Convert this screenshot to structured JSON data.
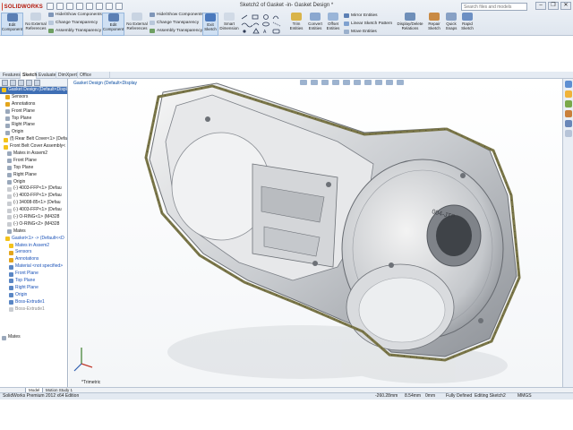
{
  "app": {
    "name": "SOLIDWORKS",
    "window_title": "Sketch2 of Gasket -in- Gasket Design *",
    "search_placeholder": "Search files and models",
    "win_minimize": "–",
    "win_restore": "❐",
    "win_close": "✕"
  },
  "ribbon": {
    "edit_component": "Edit Component",
    "no_external_references": "No External References",
    "hide_show_components": "Hide/Show Components",
    "change_transparency": "Change Transparency",
    "assembly_transparency": "Assembly Transparency",
    "edit_component_2": "Edit Component",
    "no_external_references_2": "No External References",
    "hide_show_components_2": "Hide/Show Components",
    "change_transparency_2": "Change Transparency",
    "assembly_transparency_2": "Assembly Transparency",
    "exit_sketch": "Exit Sketch",
    "smart_dimension": "Smart Dimension",
    "trim_entities": "Trim Entities",
    "convert_entities": "Convert Entities",
    "offset_entities": "Offset Entities",
    "mirror_entities": "Mirror Entities",
    "linear_sketch_pattern": "Linear Sketch Pattern",
    "move_entities": "Move Entities",
    "display_delete_relations": "Display/Delete Relations",
    "repair_sketch": "Repair Sketch",
    "quick_snaps": "Quick Snaps",
    "rapid_sketch": "Rapid Sketch"
  },
  "tabs": [
    "Features",
    "Sketch",
    "Evaluate",
    "DimXpert",
    "Office Products"
  ],
  "active_tab": "Sketch",
  "tree": [
    {
      "label": "Gasket Design  (Default<Display",
      "style": "hl",
      "color": "#f3c21b"
    },
    {
      "label": "Sensors",
      "style": "",
      "color": "#e3a51c"
    },
    {
      "label": "Annotations",
      "style": "",
      "color": "#e3a51c"
    },
    {
      "label": "Front Plane",
      "style": "",
      "color": "#9aa8bb"
    },
    {
      "label": "Top Plane",
      "style": "",
      "color": "#9aa8bb"
    },
    {
      "label": "Right Plane",
      "style": "",
      "color": "#9aa8bb"
    },
    {
      "label": "Origin",
      "style": "",
      "color": "#9aa8bb"
    },
    {
      "label": "(f) Rear Belt Cover<1> (Defa",
      "style": "",
      "color": "#f3c21b"
    },
    {
      "label": "Front Belt Cover Assembly<",
      "style": "",
      "color": "#f3c21b"
    },
    {
      "label": "Mates in Assem2",
      "style": "",
      "color": "#9aa8bb"
    },
    {
      "label": "Front Plane",
      "style": "",
      "color": "#9aa8bb"
    },
    {
      "label": "Top Plane",
      "style": "",
      "color": "#9aa8bb"
    },
    {
      "label": "Right Plane",
      "style": "",
      "color": "#9aa8bb"
    },
    {
      "label": "Origin",
      "style": "",
      "color": "#9aa8bb"
    },
    {
      "label": "(-) 4003-FFP<1> (Defau",
      "style": "",
      "color": "#c9ccd1"
    },
    {
      "label": "(-) 4003-FFP<1> (Defau",
      "style": "",
      "color": "#c9ccd1"
    },
    {
      "label": "(-) 34008-85<1> (Defau",
      "style": "",
      "color": "#c9ccd1"
    },
    {
      "label": "(-) 4003-FFP<1> (Defau",
      "style": "",
      "color": "#c9ccd1"
    },
    {
      "label": "(-) O-RING<1> (M4328",
      "style": "",
      "color": "#c9ccd1"
    },
    {
      "label": "(-) O-RING<2> (M4328",
      "style": "",
      "color": "#c9ccd1"
    },
    {
      "label": "Mates",
      "style": "",
      "color": "#9aa8bb"
    },
    {
      "label": "Gasket<1> -> (Default<<D",
      "style": "blue",
      "color": "#f3c21b"
    },
    {
      "label": "Mates in Assem2",
      "style": "blue",
      "color": "#f3c21b"
    },
    {
      "label": "Sensors",
      "style": "blue",
      "color": "#e3a51c"
    },
    {
      "label": "Annotations",
      "style": "blue",
      "color": "#e3a51c"
    },
    {
      "label": "Material <not specified>",
      "style": "blue",
      "color": "#5a86c4"
    },
    {
      "label": "Front Plane",
      "style": "blue",
      "color": "#5a86c4"
    },
    {
      "label": "Top Plane",
      "style": "blue",
      "color": "#5a86c4"
    },
    {
      "label": "Right Plane",
      "style": "blue",
      "color": "#5a86c4"
    },
    {
      "label": "Origin",
      "style": "blue",
      "color": "#5a86c4"
    },
    {
      "label": "Boss-Extrude1",
      "style": "blue",
      "color": "#5a86c4"
    },
    {
      "label": "Boss-Extrude1",
      "style": "grey",
      "color": "#c9ccd1"
    },
    {
      "label": "",
      "style": "",
      "color": "#ffffff"
    },
    {
      "label": "",
      "style": "",
      "color": "#ffffff"
    },
    {
      "label": "",
      "style": "",
      "color": "#ffffff"
    },
    {
      "label": "Mates",
      "style": "",
      "color": "#9aa8bb"
    }
  ],
  "viewport": {
    "tree_title": "Gasket Design (Default<Display",
    "view_label": "*Trimetric",
    "part_marking": "004-JTP"
  },
  "doc_tabs": [
    "Model",
    "Motion Study 1"
  ],
  "status": {
    "edition": "SolidWorks Premium 2012 x64 Edition",
    "x": "-260.28mm",
    "y": "8.54mm",
    "z": "0mm",
    "state": "Fully Defined",
    "editing": "Editing Sketch2",
    "units": "MMGS"
  },
  "colors": {
    "accent": "#3f6fb5",
    "gasket": "#7a7648",
    "brand_red": "#b3170a"
  }
}
